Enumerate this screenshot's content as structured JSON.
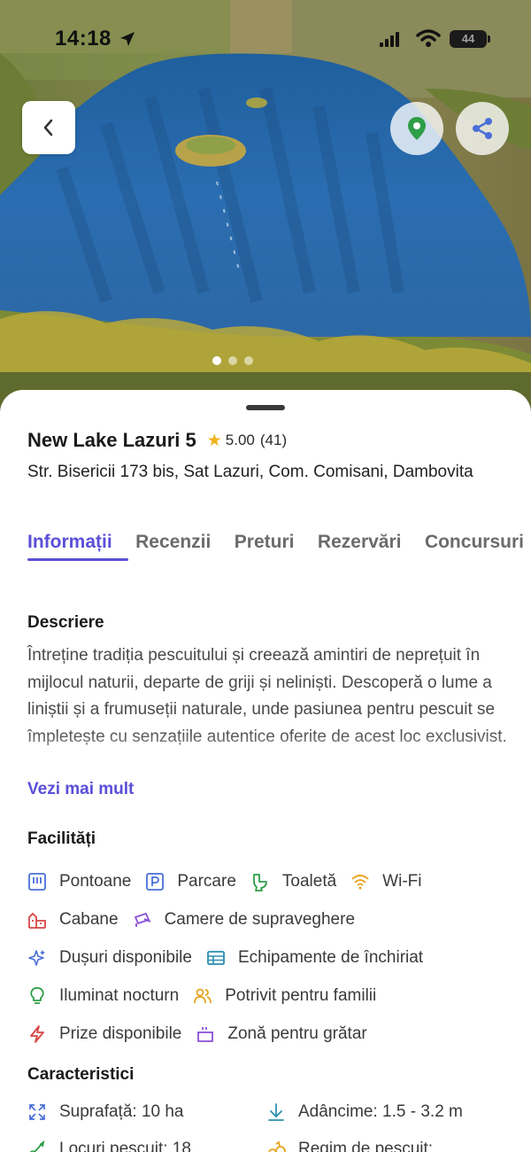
{
  "status_bar": {
    "time": "14:18",
    "battery": "44"
  },
  "hero": {
    "image_label": "aerial-lake-photo",
    "slides": 3,
    "active_slide": 1
  },
  "lake": {
    "name": "New Lake Lazuri 5",
    "rating": "5.00",
    "reviews_count": "(41)",
    "address": "Str. Bisericii 173 bis, Sat Lazuri, Com. Comisani, Dambovita"
  },
  "tabs": [
    {
      "label": "Informații",
      "active": true
    },
    {
      "label": "Recenzii"
    },
    {
      "label": "Preturi"
    },
    {
      "label": "Rezervări"
    },
    {
      "label": "Concursuri"
    }
  ],
  "description": {
    "heading": "Descriere",
    "text": "Întreține tradiția pescuitului și creează amintiri de neprețuit în mijlocul naturii, departe de griji și neliniști. Descoperă o lume a liniștii și a frumuseții naturale, unde pasiunea pentru pescuit se împletește cu senzațiile autentice oferite de acest loc exclusivist.",
    "more_label": "Vezi mai mult"
  },
  "facilities": {
    "heading": "Facilități",
    "rows": [
      [
        {
          "label": "Pontoane",
          "icon": "pontoon-icon"
        },
        {
          "label": "Parcare",
          "icon": "parking-icon"
        },
        {
          "label": "Toaletă",
          "icon": "toilet-icon"
        },
        {
          "label": "Wi-Fi",
          "icon": "wifi-icon"
        }
      ],
      [
        {
          "label": "Cabane",
          "icon": "cabin-icon"
        },
        {
          "label": "Camere de supraveghere",
          "icon": "camera-icon"
        }
      ],
      [
        {
          "label": "Dușuri disponibile",
          "icon": "shower-icon"
        },
        {
          "label": "Echipamente de închiriat",
          "icon": "equipment-icon"
        }
      ],
      [
        {
          "label": "Iluminat nocturn",
          "icon": "light-icon"
        },
        {
          "label": "Potrivit pentru familii",
          "icon": "family-icon"
        }
      ],
      [
        {
          "label": "Prize disponibile",
          "icon": "power-icon"
        },
        {
          "label": "Zonă pentru grătar",
          "icon": "grill-icon"
        }
      ]
    ]
  },
  "characteristics": {
    "heading": "Caracteristici",
    "items": [
      {
        "label": "Suprafață: 10 ha",
        "icon": "area-icon"
      },
      {
        "label": "Adâncime: 1.5 - 3.2 m",
        "icon": "depth-icon"
      },
      {
        "label": "Locuri pescuit: 18",
        "icon": "spots-icon"
      },
      {
        "label": "Regim de pescuit:",
        "icon": "regime-icon"
      }
    ]
  },
  "colors": {
    "accent": "#5a4fd8",
    "star": "#f2b21a",
    "map_pin": "#2e9e48",
    "share": "#4a6fd8"
  }
}
